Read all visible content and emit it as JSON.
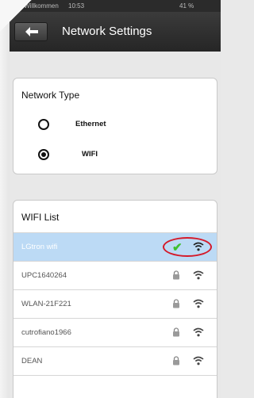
{
  "status_bar": {
    "carrier": "••••• Willkommen",
    "time": "10:53",
    "battery": "41 %"
  },
  "nav": {
    "title": "Network Settings"
  },
  "network_type": {
    "title": "Network Type",
    "options": [
      {
        "label": "Ethernet",
        "selected": false
      },
      {
        "label": "WIFI",
        "selected": true
      }
    ]
  },
  "wifi_list": {
    "title": "WIFI List",
    "networks": [
      {
        "ssid": "LGtron wifi",
        "connected": true,
        "locked": false
      },
      {
        "ssid": "UPC1640264",
        "connected": false,
        "locked": true
      },
      {
        "ssid": "WLAN-21F221",
        "connected": false,
        "locked": true
      },
      {
        "ssid": "cutrofiano1966",
        "connected": false,
        "locked": true
      },
      {
        "ssid": "DEAN",
        "connected": false,
        "locked": true
      }
    ]
  },
  "colors": {
    "selected_row": "#bcdaf5",
    "checkmark": "#3fbf2f",
    "highlight_circle": "#d41a2a"
  }
}
